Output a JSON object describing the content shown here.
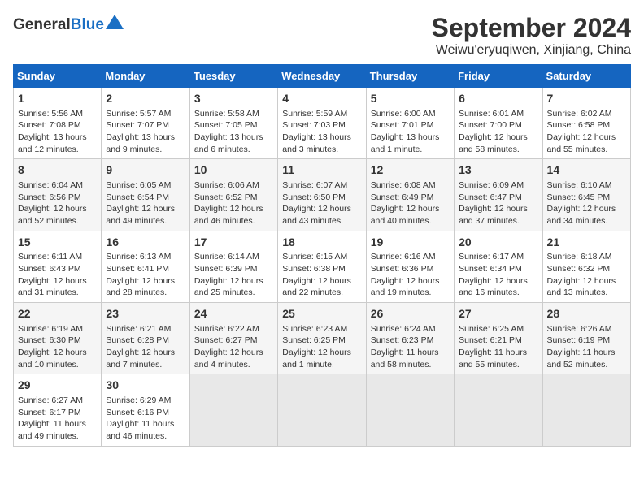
{
  "header": {
    "logo_general": "General",
    "logo_blue": "Blue",
    "title": "September 2024",
    "subtitle": "Weiwu'eryuqiwen, Xinjiang, China"
  },
  "days_of_week": [
    "Sunday",
    "Monday",
    "Tuesday",
    "Wednesday",
    "Thursday",
    "Friday",
    "Saturday"
  ],
  "weeks": [
    [
      {
        "day": "1",
        "lines": [
          "Sunrise: 5:56 AM",
          "Sunset: 7:08 PM",
          "Daylight: 13 hours",
          "and 12 minutes."
        ]
      },
      {
        "day": "2",
        "lines": [
          "Sunrise: 5:57 AM",
          "Sunset: 7:07 PM",
          "Daylight: 13 hours",
          "and 9 minutes."
        ]
      },
      {
        "day": "3",
        "lines": [
          "Sunrise: 5:58 AM",
          "Sunset: 7:05 PM",
          "Daylight: 13 hours",
          "and 6 minutes."
        ]
      },
      {
        "day": "4",
        "lines": [
          "Sunrise: 5:59 AM",
          "Sunset: 7:03 PM",
          "Daylight: 13 hours",
          "and 3 minutes."
        ]
      },
      {
        "day": "5",
        "lines": [
          "Sunrise: 6:00 AM",
          "Sunset: 7:01 PM",
          "Daylight: 13 hours",
          "and 1 minute."
        ]
      },
      {
        "day": "6",
        "lines": [
          "Sunrise: 6:01 AM",
          "Sunset: 7:00 PM",
          "Daylight: 12 hours",
          "and 58 minutes."
        ]
      },
      {
        "day": "7",
        "lines": [
          "Sunrise: 6:02 AM",
          "Sunset: 6:58 PM",
          "Daylight: 12 hours",
          "and 55 minutes."
        ]
      }
    ],
    [
      {
        "day": "8",
        "lines": [
          "Sunrise: 6:04 AM",
          "Sunset: 6:56 PM",
          "Daylight: 12 hours",
          "and 52 minutes."
        ]
      },
      {
        "day": "9",
        "lines": [
          "Sunrise: 6:05 AM",
          "Sunset: 6:54 PM",
          "Daylight: 12 hours",
          "and 49 minutes."
        ]
      },
      {
        "day": "10",
        "lines": [
          "Sunrise: 6:06 AM",
          "Sunset: 6:52 PM",
          "Daylight: 12 hours",
          "and 46 minutes."
        ]
      },
      {
        "day": "11",
        "lines": [
          "Sunrise: 6:07 AM",
          "Sunset: 6:50 PM",
          "Daylight: 12 hours",
          "and 43 minutes."
        ]
      },
      {
        "day": "12",
        "lines": [
          "Sunrise: 6:08 AM",
          "Sunset: 6:49 PM",
          "Daylight: 12 hours",
          "and 40 minutes."
        ]
      },
      {
        "day": "13",
        "lines": [
          "Sunrise: 6:09 AM",
          "Sunset: 6:47 PM",
          "Daylight: 12 hours",
          "and 37 minutes."
        ]
      },
      {
        "day": "14",
        "lines": [
          "Sunrise: 6:10 AM",
          "Sunset: 6:45 PM",
          "Daylight: 12 hours",
          "and 34 minutes."
        ]
      }
    ],
    [
      {
        "day": "15",
        "lines": [
          "Sunrise: 6:11 AM",
          "Sunset: 6:43 PM",
          "Daylight: 12 hours",
          "and 31 minutes."
        ]
      },
      {
        "day": "16",
        "lines": [
          "Sunrise: 6:13 AM",
          "Sunset: 6:41 PM",
          "Daylight: 12 hours",
          "and 28 minutes."
        ]
      },
      {
        "day": "17",
        "lines": [
          "Sunrise: 6:14 AM",
          "Sunset: 6:39 PM",
          "Daylight: 12 hours",
          "and 25 minutes."
        ]
      },
      {
        "day": "18",
        "lines": [
          "Sunrise: 6:15 AM",
          "Sunset: 6:38 PM",
          "Daylight: 12 hours",
          "and 22 minutes."
        ]
      },
      {
        "day": "19",
        "lines": [
          "Sunrise: 6:16 AM",
          "Sunset: 6:36 PM",
          "Daylight: 12 hours",
          "and 19 minutes."
        ]
      },
      {
        "day": "20",
        "lines": [
          "Sunrise: 6:17 AM",
          "Sunset: 6:34 PM",
          "Daylight: 12 hours",
          "and 16 minutes."
        ]
      },
      {
        "day": "21",
        "lines": [
          "Sunrise: 6:18 AM",
          "Sunset: 6:32 PM",
          "Daylight: 12 hours",
          "and 13 minutes."
        ]
      }
    ],
    [
      {
        "day": "22",
        "lines": [
          "Sunrise: 6:19 AM",
          "Sunset: 6:30 PM",
          "Daylight: 12 hours",
          "and 10 minutes."
        ]
      },
      {
        "day": "23",
        "lines": [
          "Sunrise: 6:21 AM",
          "Sunset: 6:28 PM",
          "Daylight: 12 hours",
          "and 7 minutes."
        ]
      },
      {
        "day": "24",
        "lines": [
          "Sunrise: 6:22 AM",
          "Sunset: 6:27 PM",
          "Daylight: 12 hours",
          "and 4 minutes."
        ]
      },
      {
        "day": "25",
        "lines": [
          "Sunrise: 6:23 AM",
          "Sunset: 6:25 PM",
          "Daylight: 12 hours",
          "and 1 minute."
        ]
      },
      {
        "day": "26",
        "lines": [
          "Sunrise: 6:24 AM",
          "Sunset: 6:23 PM",
          "Daylight: 11 hours",
          "and 58 minutes."
        ]
      },
      {
        "day": "27",
        "lines": [
          "Sunrise: 6:25 AM",
          "Sunset: 6:21 PM",
          "Daylight: 11 hours",
          "and 55 minutes."
        ]
      },
      {
        "day": "28",
        "lines": [
          "Sunrise: 6:26 AM",
          "Sunset: 6:19 PM",
          "Daylight: 11 hours",
          "and 52 minutes."
        ]
      }
    ],
    [
      {
        "day": "29",
        "lines": [
          "Sunrise: 6:27 AM",
          "Sunset: 6:17 PM",
          "Daylight: 11 hours",
          "and 49 minutes."
        ]
      },
      {
        "day": "30",
        "lines": [
          "Sunrise: 6:29 AM",
          "Sunset: 6:16 PM",
          "Daylight: 11 hours",
          "and 46 minutes."
        ]
      },
      {
        "day": "",
        "lines": []
      },
      {
        "day": "",
        "lines": []
      },
      {
        "day": "",
        "lines": []
      },
      {
        "day": "",
        "lines": []
      },
      {
        "day": "",
        "lines": []
      }
    ]
  ]
}
